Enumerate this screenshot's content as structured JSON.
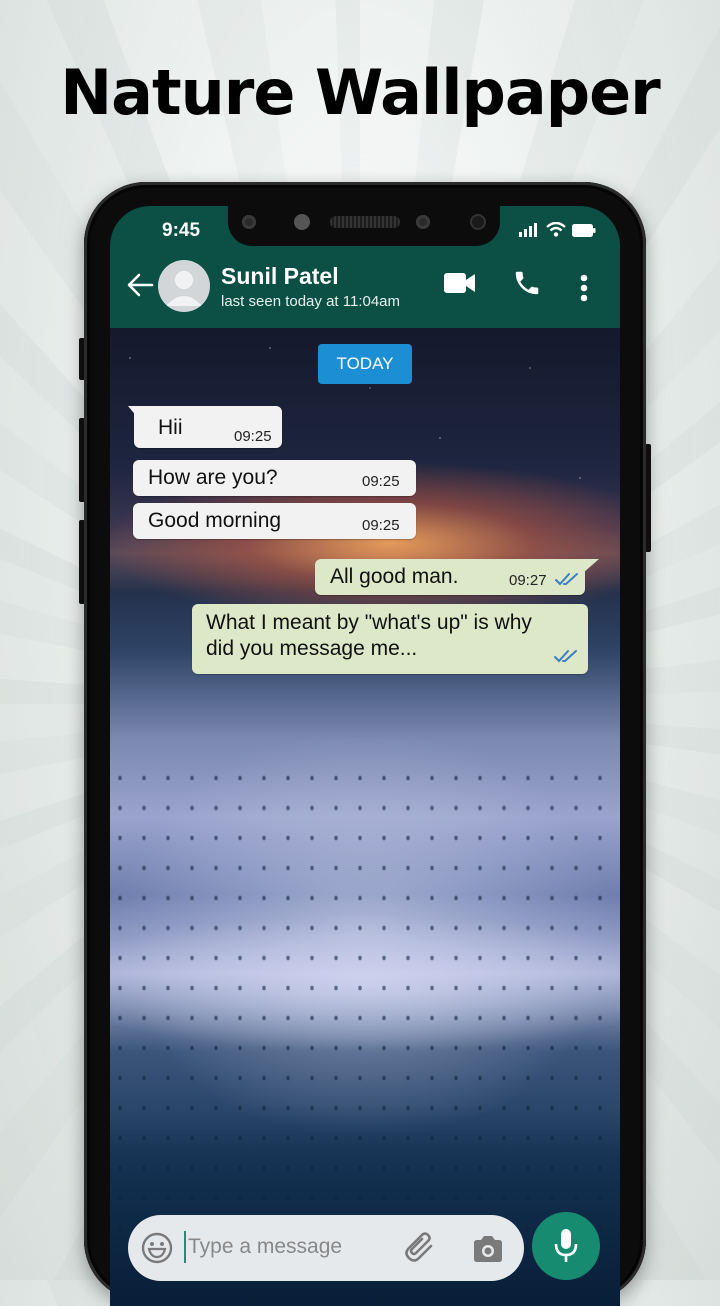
{
  "headline": "Nature Wallpaper",
  "status_bar": {
    "time": "9:45",
    "icons": [
      "signal-icon",
      "wifi-icon",
      "battery-icon"
    ]
  },
  "chat_header": {
    "back_icon": "arrow-left-icon",
    "contact_name": "Sunil Patel",
    "last_seen": "last seen today at 11:04am",
    "actions": [
      "video-call-icon",
      "phone-icon",
      "more-vert-icon"
    ]
  },
  "date_badge": "TODAY",
  "messages": [
    {
      "direction": "incoming",
      "text": "Hii",
      "time": "09:25"
    },
    {
      "direction": "incoming",
      "text": "How are you?",
      "time": "09:25"
    },
    {
      "direction": "incoming",
      "text": "Good morning",
      "time": "09:25"
    },
    {
      "direction": "outgoing",
      "text": "All good man.",
      "time": "09:27",
      "status": "read"
    },
    {
      "direction": "outgoing",
      "text_line1": "What I meant by \"what's up\" is why",
      "text_line2": "did you message me...",
      "status": "read"
    }
  ],
  "composer": {
    "placeholder": "Type a message",
    "emoji_icon": "emoji-icon",
    "attach_icon": "paperclip-icon",
    "camera_icon": "camera-icon",
    "mic_icon": "microphone-icon"
  },
  "colors": {
    "header_green": "#0b4f45",
    "today_badge": "#1c8ed3",
    "incoming_bubble": "#f2f2f2",
    "outgoing_bubble": "#dce8c8",
    "mic_button": "#168b70",
    "read_ticks": "#3b7fc4"
  }
}
